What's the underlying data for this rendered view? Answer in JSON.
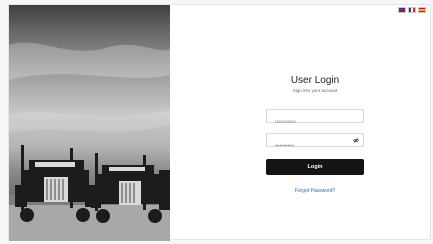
{
  "languages": [
    {
      "code": "en",
      "icon": "uk-flag-icon"
    },
    {
      "code": "fr",
      "icon": "france-flag-icon"
    },
    {
      "code": "es",
      "icon": "spain-flag-icon"
    }
  ],
  "login": {
    "title": "User Login",
    "subtitle": "Sign into your account",
    "username_placeholder": "Username",
    "password_placeholder": "••••••••••••",
    "password_toggle_icon": "eye-slash-icon",
    "login_label": "Login",
    "forgot_label": "Forgot Password?"
  },
  "colors": {
    "button": "#141414",
    "link": "#2f6fb0"
  }
}
